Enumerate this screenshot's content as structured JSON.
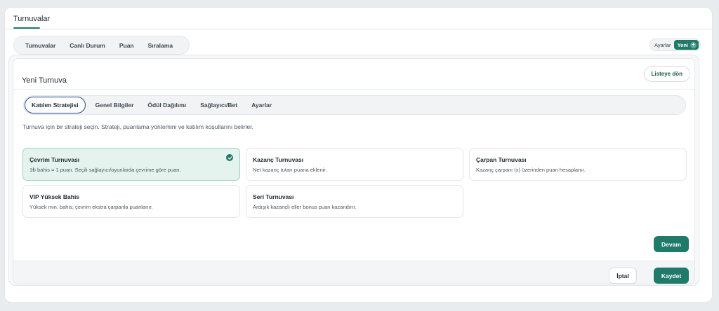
{
  "header": {
    "title": "Turnuvalar"
  },
  "top_tabs": [
    {
      "label": "Turnuvalar"
    },
    {
      "label": "Canlı Durum"
    },
    {
      "label": "Puan"
    },
    {
      "label": "Sıralama"
    }
  ],
  "actions": {
    "settings_label": "Ayarlar",
    "new_label": "Yeni",
    "new_icon": "plus-icon"
  },
  "card": {
    "title": "Yeni Turnuva",
    "back_label": "Listeye dön",
    "step_tabs": [
      {
        "label": "Katılım Stratejisi",
        "active": true
      },
      {
        "label": "Genel Bilgiler"
      },
      {
        "label": "Ödül Dağılımı"
      },
      {
        "label": "Sağlayıcı/Bet"
      },
      {
        "label": "Ayarlar"
      }
    ],
    "intro": "Turnuva için bir strateji seçin. Strateji, puanlama yöntemini ve katılım koşullarını belirler.",
    "options": [
      {
        "title": "Çevrim Turnuvası",
        "desc": "1₺ bahis = 1 puan. Seçili sağlayıcı/oyunlarda çevrime göre puan.",
        "selected": true
      },
      {
        "title": "Kazanç Turnuvası",
        "desc": "Net kazanç tutarı puana eklenir."
      },
      {
        "title": "Çarpan Turnuvası",
        "desc": "Kazanç çarpanı (x) üzerinden puan hesaplanır."
      },
      {
        "title": "VIP Yüksek Bahis",
        "desc": "Yüksek min. bahis; çevrim ekstra çarpanla puanlanır."
      },
      {
        "title": "Seri Turnuvası",
        "desc": "Ardışık kazançlı eller bonus puan kazandırır."
      }
    ],
    "continue_label": "Devam",
    "cancel_label": "İptal",
    "save_label": "Kaydet"
  },
  "colors": {
    "accent": "#1f7a6a",
    "selected_bg": "#e5f3ee",
    "active_tab_border": "#1f4d8a"
  }
}
